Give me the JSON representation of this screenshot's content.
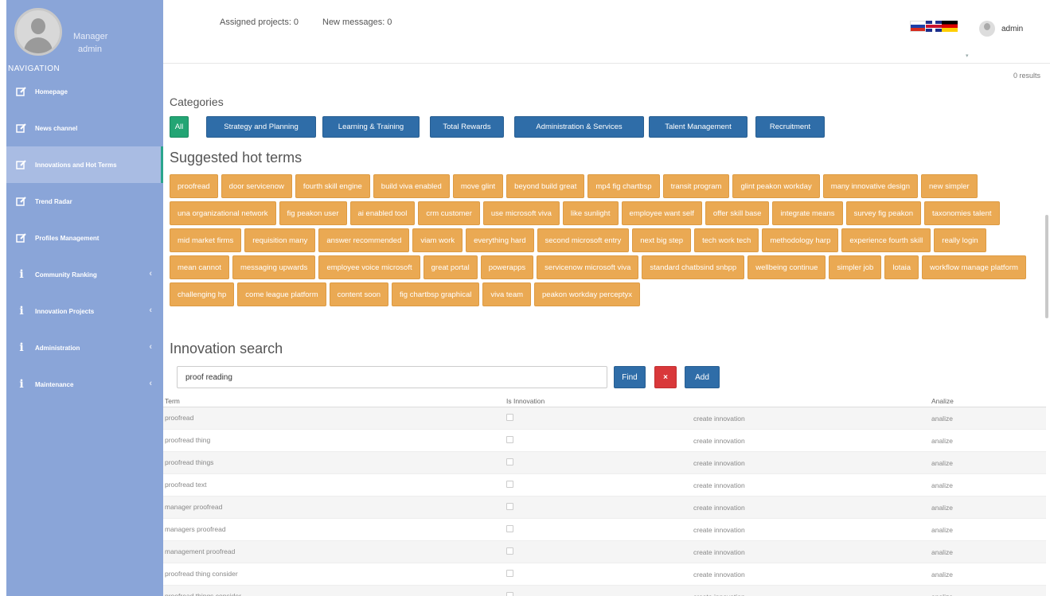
{
  "sidebar": {
    "role": "Manager",
    "username": "admin",
    "nav_label": "NAVIGATION",
    "items": [
      {
        "label": "Homepage",
        "icon": "edit-icon"
      },
      {
        "label": "News channel",
        "icon": "edit-icon"
      },
      {
        "label": "Innovations and Hot Terms",
        "icon": "edit-icon"
      },
      {
        "label": "Trend Radar",
        "icon": "edit-icon"
      },
      {
        "label": "Profiles Management",
        "icon": "edit-icon"
      },
      {
        "label": "Community Ranking",
        "icon": "info-icon"
      },
      {
        "label": "Innovation Projects",
        "icon": "info-icon"
      },
      {
        "label": "Administration",
        "icon": "info-icon"
      },
      {
        "label": "Maintenance",
        "icon": "info-icon"
      }
    ]
  },
  "topbar": {
    "assigned_projects": "Assigned projects: 0",
    "new_messages": "New messages: 0",
    "user": "admin",
    "results": "0 results"
  },
  "categories": {
    "title": "Categories",
    "items": [
      "All",
      "Strategy and Planning",
      "Learning & Training",
      "Total Rewards",
      "Administration & Services",
      "Talent Management",
      "Recruitment"
    ]
  },
  "hot_terms": {
    "title": "Suggested hot terms",
    "items": [
      "proofread",
      "door servicenow",
      "fourth skill engine",
      "build viva enabled",
      "move glint",
      "beyond build great",
      "mp4 fig chartbsp",
      "transit program",
      "glint peakon workday",
      "many innovative design",
      "new simpler",
      "una organizational network",
      "fig peakon user",
      "ai enabled tool",
      "crm customer",
      "use microsoft viva",
      "like sunlight",
      "employee want self",
      "offer skill base",
      "integrate means",
      "survey fig peakon",
      "taxonomies talent",
      "mid market firms",
      "requisition many",
      "answer recommended",
      "viam work",
      "everything hard",
      "second microsoft entry",
      "next big step",
      "tech work tech",
      "methodology harp",
      "experience fourth skill",
      "really login",
      "mean cannot",
      "messaging upwards",
      "employee voice microsoft",
      "great portal",
      "powerapps",
      "servicenow microsoft viva",
      "standard chatbsind snbpp",
      "wellbeing continue",
      "simpler job",
      "lotaia",
      "workflow manage platform",
      "challenging hp",
      "come league platform",
      "content soon",
      "fig chartbsp graphical",
      "viva team",
      "peakon workday perceptyx"
    ]
  },
  "search": {
    "title": "Innovation search",
    "value": "proof reading",
    "find_label": "Find",
    "clear_label": "×",
    "add_label": "Add"
  },
  "table": {
    "headers": {
      "term": "Term",
      "is_innovation": "Is Innovation",
      "analize": "Analize"
    },
    "rows": [
      {
        "term": "proofread",
        "create": "create innovation",
        "analize": "analize"
      },
      {
        "term": "proofread thing",
        "create": "create innovation",
        "analize": "analize"
      },
      {
        "term": "proofread things",
        "create": "create innovation",
        "analize": "analize"
      },
      {
        "term": "proofread text",
        "create": "create innovation",
        "analize": "analize"
      },
      {
        "term": "manager proofread",
        "create": "create innovation",
        "analize": "analize"
      },
      {
        "term": "managers proofread",
        "create": "create innovation",
        "analize": "analize"
      },
      {
        "term": "management proofread",
        "create": "create innovation",
        "analize": "analize"
      },
      {
        "term": "proofread thing consider",
        "create": "create innovation",
        "analize": "analize"
      },
      {
        "term": "proofread things consider",
        "create": "create innovation",
        "analize": "analize"
      }
    ]
  },
  "colors": {
    "sidebar": "#8aa5d8",
    "primary": "#2f6da8",
    "success": "#23a574",
    "warning": "#eaa953",
    "danger": "#d9383a"
  }
}
